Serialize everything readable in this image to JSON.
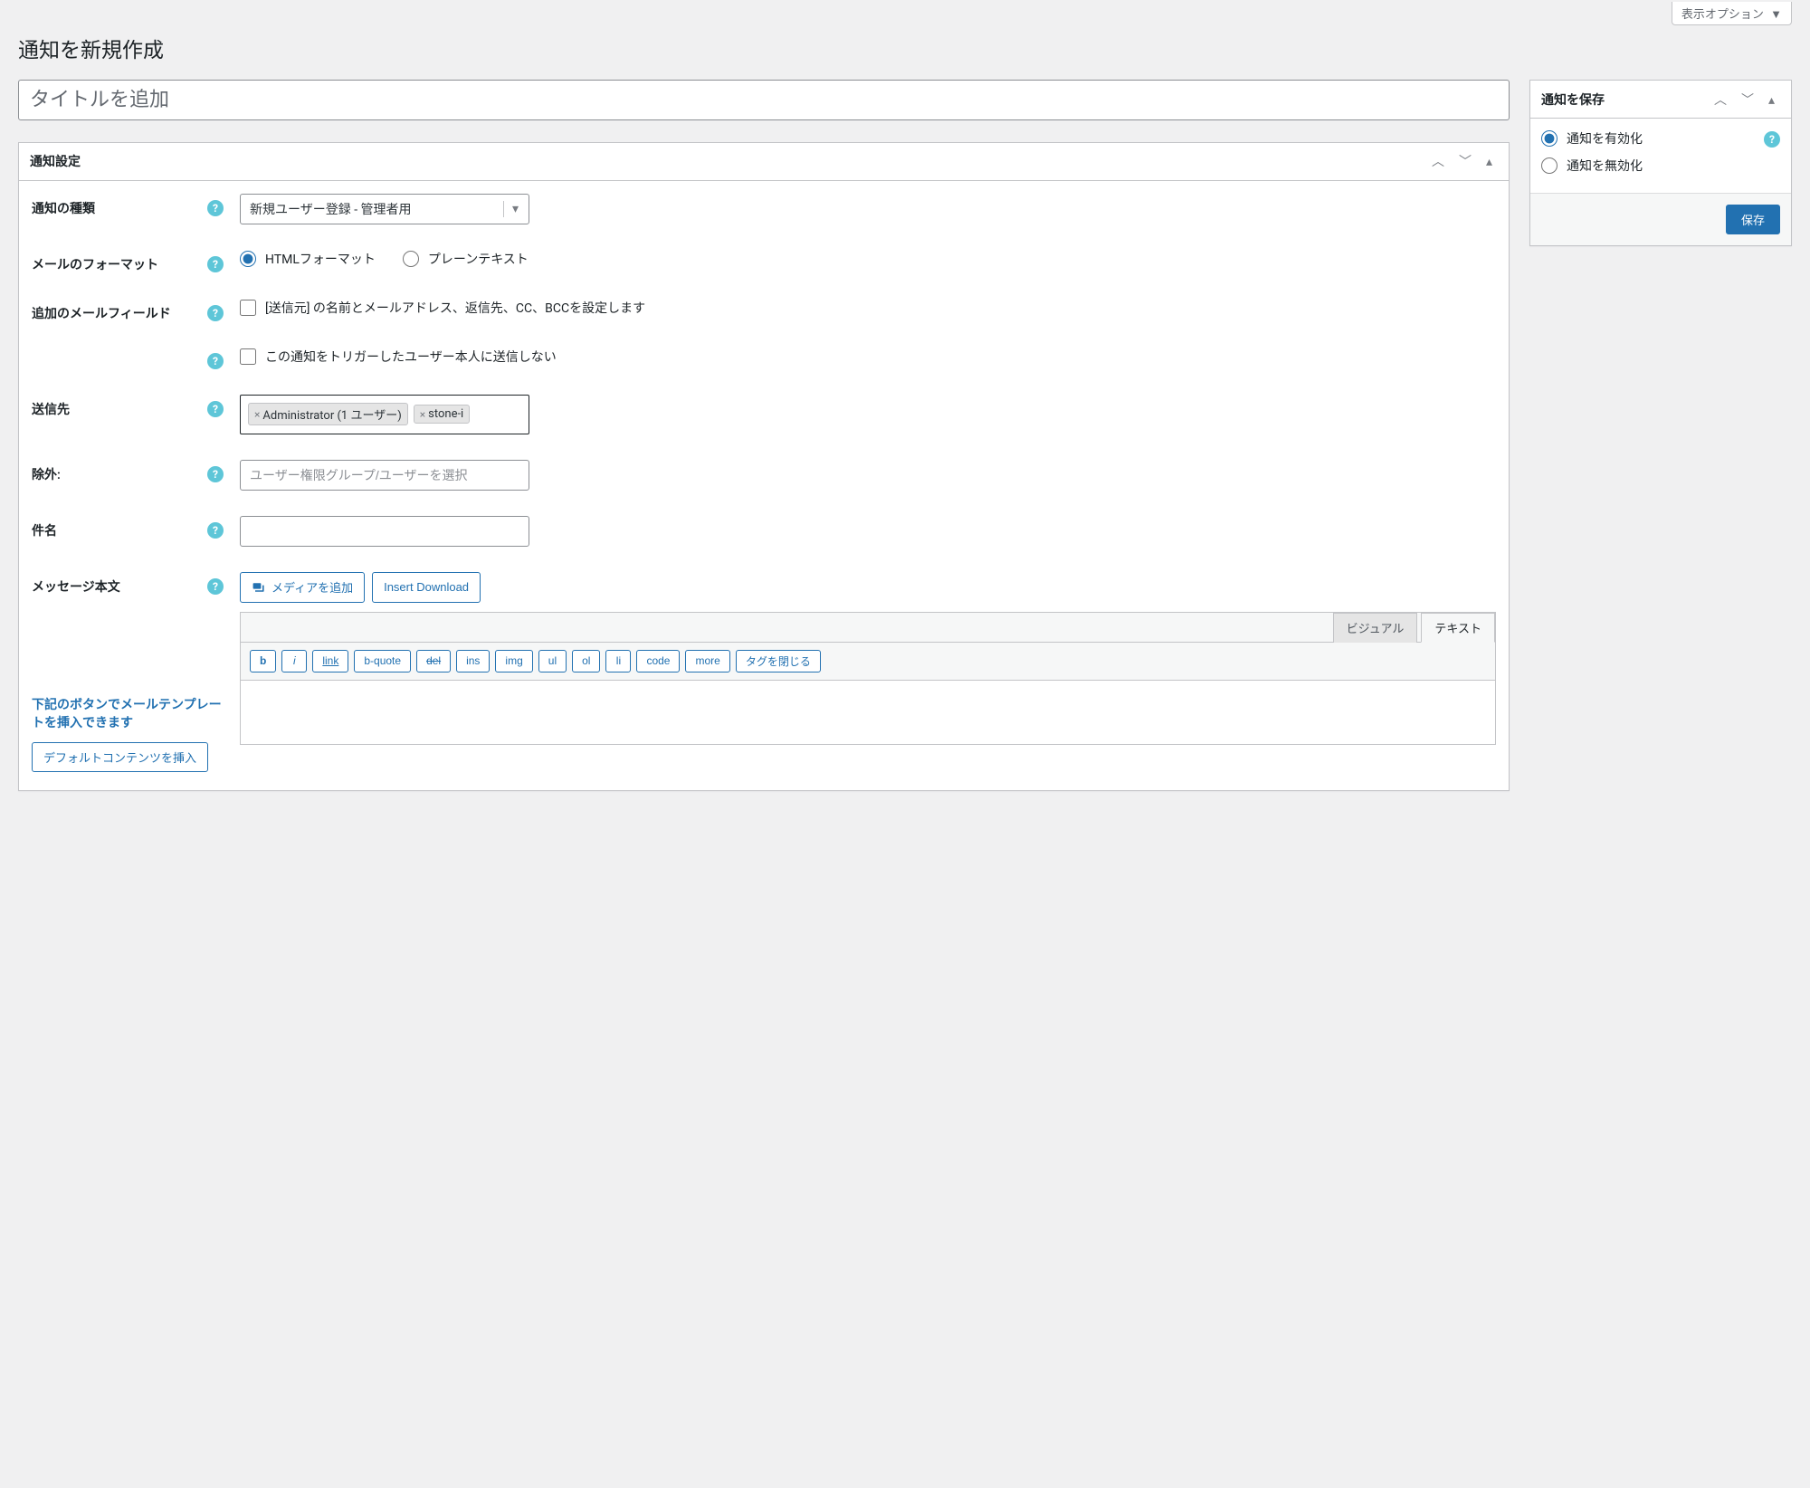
{
  "screen_options_label": "表示オプション",
  "page_title": "通知を新規作成",
  "title_placeholder": "タイトルを追加",
  "settings_box": {
    "title": "通知設定"
  },
  "fields": {
    "type": {
      "label": "通知の種類",
      "selected": "新規ユーザー登録 - 管理者用"
    },
    "format": {
      "label": "メールのフォーマット",
      "options": {
        "html": "HTMLフォーマット",
        "plain": "プレーンテキスト"
      },
      "checked": "html"
    },
    "extra": {
      "label": "追加のメールフィールド",
      "from_text": "[送信元] の名前とメールアドレス、返信先、CC、BCCを設定します",
      "exclude_self": "この通知をトリガーしたユーザー本人に送信しない"
    },
    "recipients": {
      "label": "送信先",
      "tags": [
        "Administrator (1 ユーザー)",
        "stone-i"
      ]
    },
    "exclude": {
      "label": "除外:",
      "placeholder": "ユーザー権限グループ/ユーザーを選択"
    },
    "subject": {
      "label": "件名",
      "value": ""
    },
    "message": {
      "label": "メッセージ本文"
    }
  },
  "media_button": "メディアを追加",
  "insert_download": "Insert Download",
  "editor_tabs": {
    "visual": "ビジュアル",
    "text": "テキスト"
  },
  "quicktags": [
    "b",
    "i",
    "link",
    "b-quote",
    "del",
    "ins",
    "img",
    "ul",
    "ol",
    "li",
    "code",
    "more",
    "タグを閉じる"
  ],
  "template_hint": "下記のボタンでメールテンプレートを挿入できます",
  "insert_default": "デフォルトコンテンツを挿入",
  "sidebar": {
    "title": "通知を保存",
    "enable": "通知を有効化",
    "disable": "通知を無効化",
    "save": "保存"
  }
}
